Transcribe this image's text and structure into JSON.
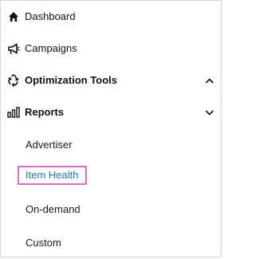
{
  "nav": {
    "dashboard": {
      "label": "Dashboard",
      "icon": "home-icon"
    },
    "campaigns": {
      "label": "Campaigns",
      "icon": "megaphone-icon"
    },
    "optimization_tools": {
      "label": "Optimization Tools",
      "icon": "recycle-icon",
      "expanded": false
    },
    "reports": {
      "label": "Reports",
      "icon": "bar-chart-icon",
      "expanded": true,
      "items": [
        {
          "label": "Advertiser",
          "active": false
        },
        {
          "label": "Item Health",
          "active": true
        },
        {
          "label": "On-demand",
          "active": false
        },
        {
          "label": "Custom",
          "active": false
        }
      ]
    }
  },
  "colors": {
    "active_text": "#1f78b4",
    "highlight_border": "#d96cc5",
    "text": "#111111"
  }
}
